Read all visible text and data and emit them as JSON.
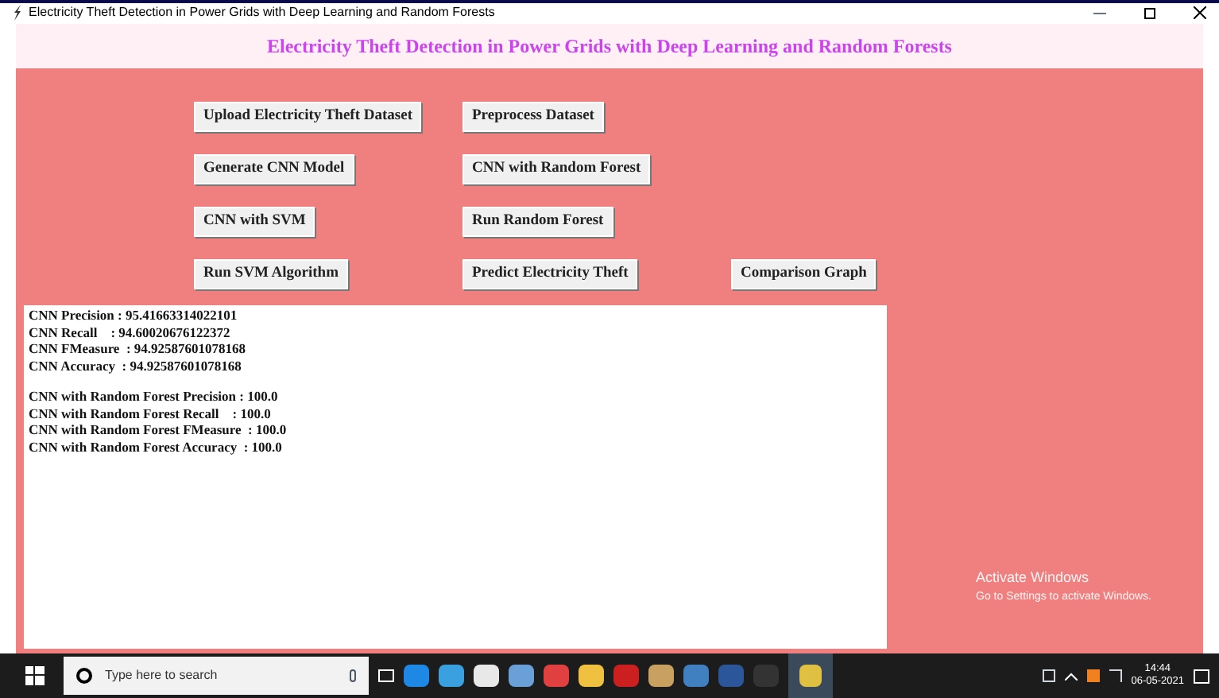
{
  "window": {
    "title": "Electricity Theft Detection in Power Grids with Deep Learning and Random Forests"
  },
  "header": {
    "title": "Electricity Theft Detection in Power Grids with Deep Learning and Random Forests"
  },
  "buttons": [
    [
      "Upload Electricity Theft Dataset",
      "Preprocess Dataset"
    ],
    [
      "Generate CNN Model",
      "CNN with Random Forest"
    ],
    [
      "CNN with SVM",
      "Run Random Forest"
    ],
    [
      "Run SVM Algorithm",
      "Predict Electricity Theft",
      "Comparison Graph"
    ]
  ],
  "output": {
    "groups": [
      [
        "CNN Precision : 95.41663314022101",
        "CNN Recall    : 94.60020676122372",
        "CNN FMeasure  : 94.92587601078168",
        "CNN Accuracy  : 94.92587601078168"
      ],
      [
        "CNN with Random Forest Precision : 100.0",
        "CNN with Random Forest Recall    : 100.0",
        "CNN with Random Forest FMeasure  : 100.0",
        "CNN with Random Forest Accuracy  : 100.0"
      ]
    ]
  },
  "activation": {
    "title": "Activate Windows",
    "subtitle": "Go to Settings to activate Windows."
  },
  "taskbar": {
    "search_placeholder": "Type here to search",
    "time": "14:44",
    "date": "06-05-2021"
  }
}
